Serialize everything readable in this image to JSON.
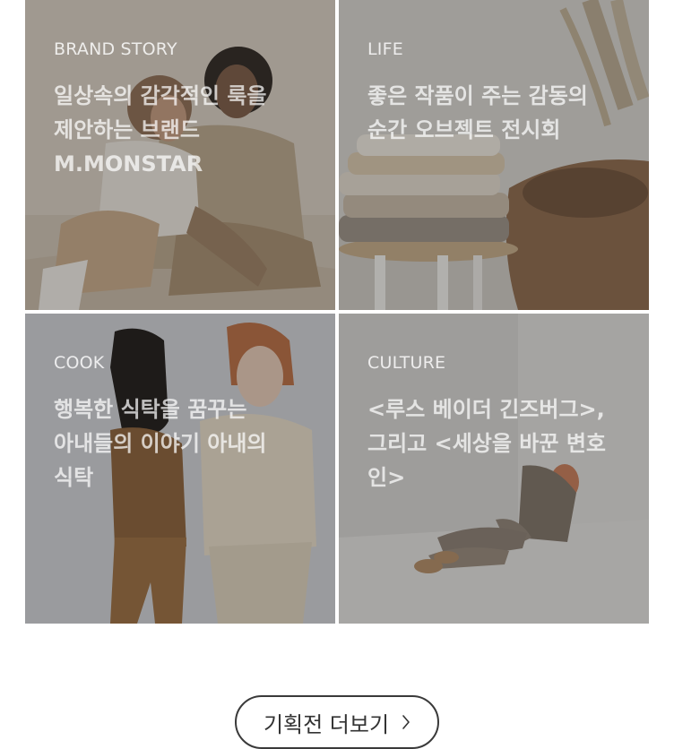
{
  "cards": [
    {
      "category": "BRAND STORY",
      "title": "일상속의 감각적인 룩을 제안하는 브랜드 M.MONSTAR"
    },
    {
      "category": "LIFE",
      "title": "좋은 작품이 주는 감동의 순간 오브젝트 전시회"
    },
    {
      "category": "COOK",
      "title": "행복한 식탁을 꿈꾸는 아내들의 이야기 아내의 식탁"
    },
    {
      "category": "CULTURE",
      "title": "<루스 베이더 긴즈버그>, 그리고 <세상을 바꾼 변호인>"
    }
  ],
  "more_button": {
    "label": "기획전 더보기",
    "icon": "chevron-right-icon"
  }
}
